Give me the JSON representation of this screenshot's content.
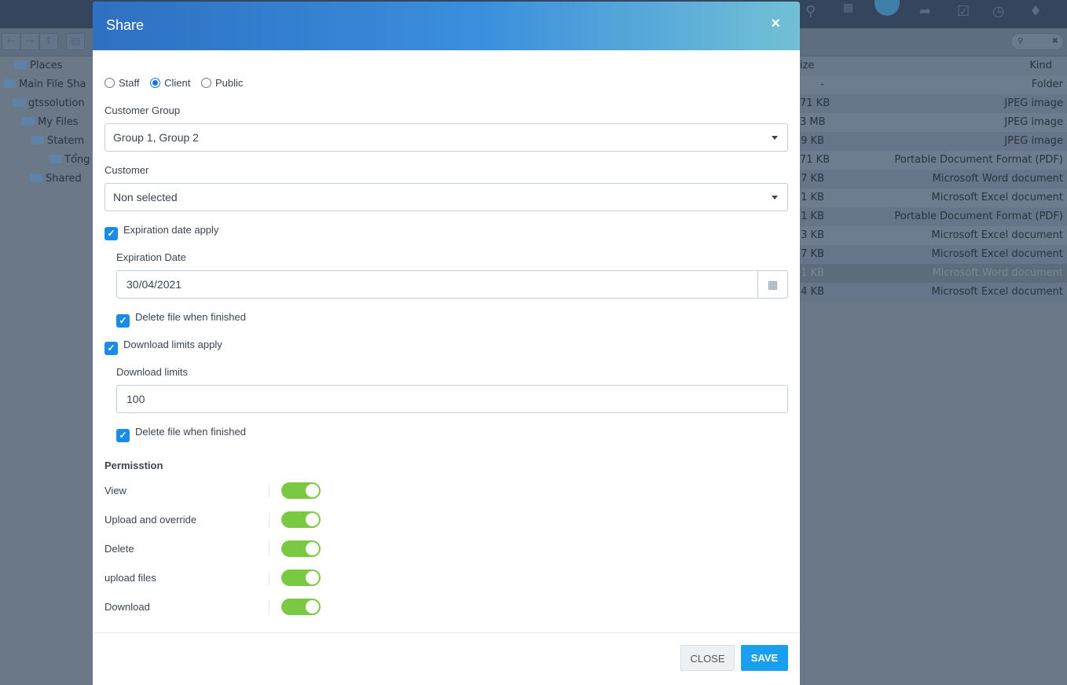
{
  "background": {
    "tree": [
      {
        "label": "Places",
        "icon": "places-icon"
      },
      {
        "label": "Main File Sha",
        "icon": "drive-icon"
      },
      {
        "label": "gtssolution",
        "icon": "folder-icon"
      },
      {
        "label": "My Files",
        "icon": "folder-icon"
      },
      {
        "label": "Statem",
        "icon": "folder-open-icon"
      },
      {
        "label": "Tổng",
        "icon": "folder-icon"
      },
      {
        "label": "Shared",
        "icon": "folder-icon"
      }
    ],
    "columns": {
      "size": "ize",
      "kind": "Kind"
    },
    "rows": [
      {
        "size": "-",
        "kind": "Folder"
      },
      {
        "size": "71 KB",
        "kind": "JPEG image"
      },
      {
        "size": "3 MB",
        "kind": "JPEG image"
      },
      {
        "size": "9 KB",
        "kind": "JPEG image"
      },
      {
        "size": "71 KB",
        "kind": "Portable Document Format (PDF)"
      },
      {
        "size": "7 KB",
        "kind": "Microsoft Word document"
      },
      {
        "size": "1 KB",
        "kind": "Microsoft Excel document"
      },
      {
        "size": "1 KB",
        "kind": "Portable Document Format (PDF)"
      },
      {
        "size": "3 KB",
        "kind": "Microsoft Excel document"
      },
      {
        "size": "7 KB",
        "kind": "Microsoft Excel document"
      },
      {
        "size": "1 KB",
        "kind": "Microsoft Word document",
        "selected": true
      },
      {
        "size": "4 KB",
        "kind": "Microsoft Excel document"
      }
    ]
  },
  "modal": {
    "title": "Share",
    "close_icon": "×",
    "share_types": [
      "Staff",
      "Client",
      "Public"
    ],
    "selected_type": "Client",
    "customer_group_label": "Customer Group",
    "customer_group_value": "Group 1, Group 2",
    "customer_label": "Customer",
    "customer_value": "Non selected",
    "expiration_apply": "Expiration date apply",
    "expiration_date_label": "Expiration Date",
    "expiration_date_value": "30/04/2021",
    "delete_when_finished_1": "Delete file when finished",
    "download_limits_apply": "Download limits apply",
    "download_limits_label": "Download limits",
    "download_limits_value": "100",
    "delete_when_finished_2": "Delete file when finished",
    "permission_title": "Permisstion",
    "permissions": [
      {
        "label": "View",
        "on": true
      },
      {
        "label": "Upload and override",
        "on": true
      },
      {
        "label": "Delete",
        "on": true
      },
      {
        "label": "upload files",
        "on": true
      },
      {
        "label": "Download",
        "on": true
      }
    ],
    "close_button": "CLOSE",
    "save_button": "SAVE",
    "accent": "#1a9ff0",
    "toggle_on": "#7ac943"
  }
}
